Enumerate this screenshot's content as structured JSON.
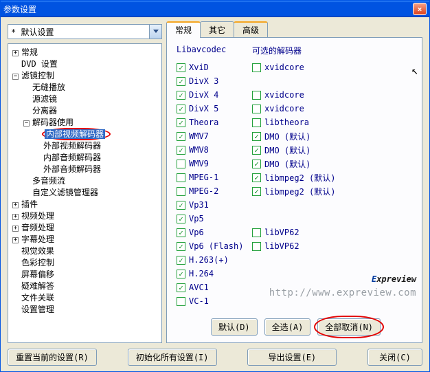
{
  "title": "参数设置",
  "preset": {
    "label": "* 默认设置"
  },
  "tree": [
    {
      "exp": "+",
      "label": "常规"
    },
    {
      "exp": "",
      "label": "DVD 设置"
    },
    {
      "exp": "-",
      "label": "滤镜控制",
      "children": [
        {
          "label": "无缝播放"
        },
        {
          "label": "源滤镜"
        },
        {
          "label": "分离器"
        },
        {
          "exp": "-",
          "label": "解码器使用",
          "children": [
            {
              "label": "内部视频解码器",
              "selected": true,
              "circled": true
            },
            {
              "label": "外部视频解码器"
            },
            {
              "label": "内部音频解码器"
            },
            {
              "label": "外部音频解码器"
            }
          ]
        },
        {
          "label": "多音频流"
        },
        {
          "label": "自定义滤镜管理器"
        }
      ]
    },
    {
      "exp": "+",
      "label": "插件"
    },
    {
      "exp": "+",
      "label": "视频处理"
    },
    {
      "exp": "+",
      "label": "音频处理"
    },
    {
      "exp": "+",
      "label": "字幕处理"
    },
    {
      "exp": "",
      "label": "视觉效果"
    },
    {
      "exp": "",
      "label": "色彩控制"
    },
    {
      "exp": "",
      "label": "屏幕偏移"
    },
    {
      "exp": "",
      "label": "疑难解答"
    },
    {
      "exp": "",
      "label": "文件关联"
    },
    {
      "exp": "",
      "label": "设置管理"
    }
  ],
  "tabs": [
    {
      "label": "常规",
      "active": true,
      "hot": true
    },
    {
      "label": "其它"
    },
    {
      "label": "高级",
      "hot": true
    }
  ],
  "headers": {
    "left": "Libavcodec",
    "right": "可选的解码器"
  },
  "codecs": [
    {
      "l": "XviD",
      "lon": true,
      "r": "xvidcore",
      "ron": false
    },
    {
      "l": "DivX 3",
      "lon": true
    },
    {
      "l": "DivX 4",
      "lon": true,
      "r": "xvidcore",
      "ron": false
    },
    {
      "l": "DivX 5",
      "lon": true,
      "r": "xvidcore",
      "ron": false
    },
    {
      "l": "Theora",
      "lon": true,
      "r": "libtheora",
      "ron": false
    },
    {
      "l": "WMV7",
      "lon": true,
      "r": "DMO (默认)",
      "ron": true
    },
    {
      "l": "WMV8",
      "lon": true,
      "r": "DMO (默认)",
      "ron": true
    },
    {
      "l": "WMV9",
      "lon": false,
      "r": "DMO (默认)",
      "ron": true
    },
    {
      "l": "MPEG-1",
      "lon": false,
      "r": "libmpeg2 (默认)",
      "ron": true
    },
    {
      "l": "MPEG-2",
      "lon": false,
      "r": "libmpeg2 (默认)",
      "ron": true
    },
    {
      "l": "Vp31",
      "lon": true
    },
    {
      "l": "Vp5",
      "lon": true
    },
    {
      "l": "Vp6",
      "lon": true,
      "r": "libVP62",
      "ron": false
    },
    {
      "l": "Vp6 (Flash)",
      "lon": true,
      "r": "libVP62",
      "ron": false
    },
    {
      "l": "H.263(+)",
      "lon": true
    },
    {
      "l": "H.264",
      "lon": true
    },
    {
      "l": "AVC1",
      "lon": true
    },
    {
      "l": "VC-1",
      "lon": false
    }
  ],
  "panelButtons": {
    "default": "默认(D)",
    "selectAll": "全选(A)",
    "cancelAll": "全部取消(N)"
  },
  "bottomButtons": {
    "resetCurrent": "重置当前的设置(R)",
    "initAll": "初始化所有设置(I)",
    "export": "导出设置(E)",
    "close": "关闭(C)"
  },
  "watermark": {
    "brand1": "E",
    "brand2": "xpreview",
    "url": "http://www.expreview.com"
  }
}
